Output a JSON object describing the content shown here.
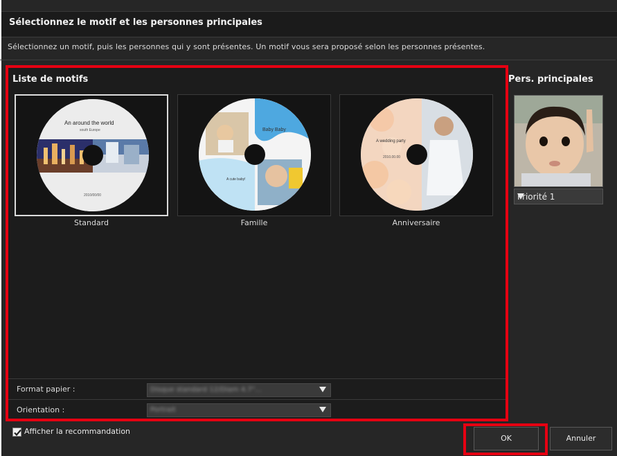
{
  "dialog": {
    "title": "Sélectionnez le motif et les personnes principales",
    "subtitle": "Sélectionnez un motif, puis les personnes qui y sont présentes. Un motif vous sera proposé selon les personnes présentes."
  },
  "motifs": {
    "heading": "Liste de motifs",
    "items": [
      {
        "label": "Standard",
        "selected": true,
        "disc_title": "An around the world",
        "disc_subtitle": "south Europe",
        "disc_date": "2010/00/00"
      },
      {
        "label": "Famille",
        "selected": false,
        "disc_title": "Baby Baby",
        "disc_caption": "A cute baby!"
      },
      {
        "label": "Anniversaire",
        "selected": false,
        "disc_title": "A wedding party",
        "disc_date": "2010.00.00"
      }
    ]
  },
  "controls": {
    "paper_label": "Format papier :",
    "paper_value": "Disque standard 12/Diam 4.7\"...",
    "orientation_label": "Orientation :",
    "orientation_value": "Portrait"
  },
  "people": {
    "heading": "Pers. principales",
    "priority_value": "Priorité 1"
  },
  "footer": {
    "checkbox_label": "Afficher la recommandation",
    "checkbox_checked": true,
    "ok_label": "OK",
    "cancel_label": "Annuler"
  },
  "colors": {
    "highlight": "#e60012",
    "background": "#262626",
    "panel": "#1c1c1c"
  }
}
